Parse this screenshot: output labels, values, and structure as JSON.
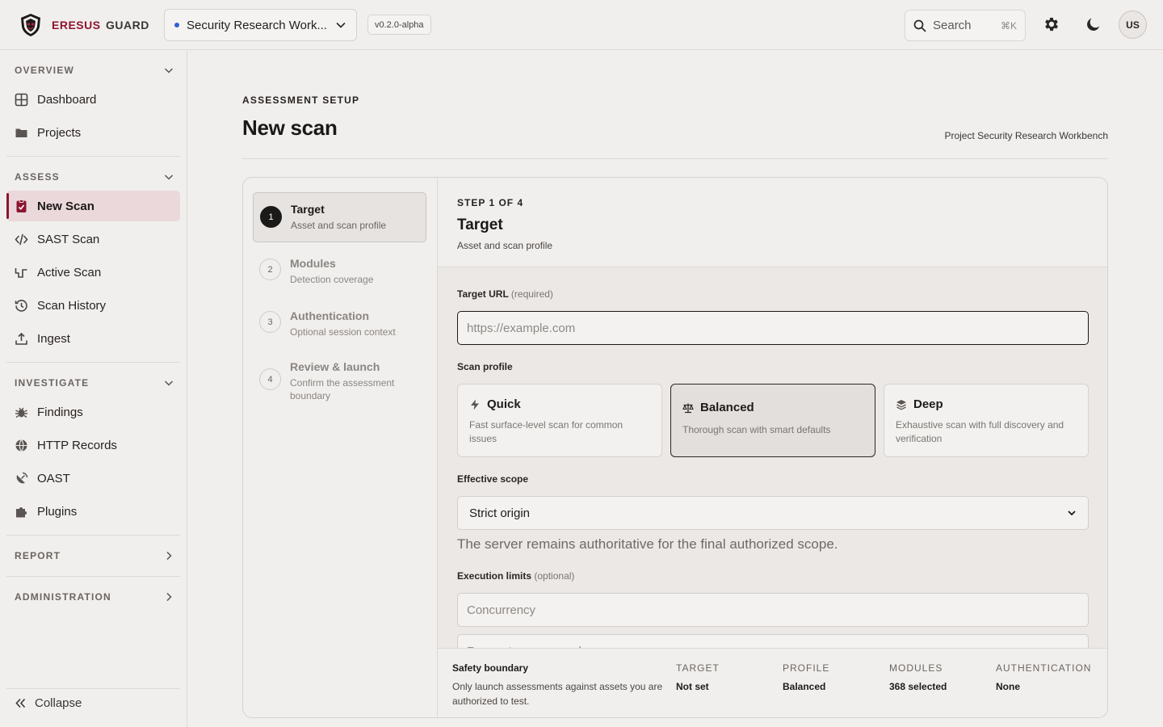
{
  "brand": {
    "name": "ERESUS",
    "suffix": "GUARD"
  },
  "header": {
    "workspace": "Security Research Work...",
    "version": "v0.2.0-alpha",
    "search_label": "Search",
    "search_shortcut": "⌘K",
    "avatar": "US"
  },
  "sidebar": {
    "overview": {
      "title": "OVERVIEW",
      "items": [
        "Dashboard",
        "Projects"
      ]
    },
    "assess": {
      "title": "ASSESS",
      "items": [
        "New Scan",
        "SAST Scan",
        "Active Scan",
        "Scan History",
        "Ingest"
      ]
    },
    "investigate": {
      "title": "INVESTIGATE",
      "items": [
        "Findings",
        "HTTP Records",
        "OAST",
        "Plugins"
      ]
    },
    "report": {
      "title": "REPORT"
    },
    "administration": {
      "title": "ADMINISTRATION"
    },
    "collapse_label": "Collapse",
    "active_item": "New Scan"
  },
  "page": {
    "eyebrow": "ASSESSMENT SETUP",
    "title": "New scan",
    "project": "Project Security Research Workbench"
  },
  "steps": [
    {
      "num": "1",
      "title": "Target",
      "sub": "Asset and scan profile",
      "active": true
    },
    {
      "num": "2",
      "title": "Modules",
      "sub": "Detection coverage",
      "active": false
    },
    {
      "num": "3",
      "title": "Authentication",
      "sub": "Optional session context",
      "active": false
    },
    {
      "num": "4",
      "title": "Review & launch",
      "sub": "Confirm the assessment boundary",
      "active": false
    }
  ],
  "content": {
    "step_of": "STEP 1 OF 4",
    "title": "Target",
    "sub": "Asset and scan profile",
    "target_url_label": "Target URL",
    "target_url_hint": "(required)",
    "target_url_placeholder": "https://example.com",
    "target_url_value": "",
    "scan_profile_label": "Scan profile",
    "profiles": [
      {
        "name": "Quick",
        "desc": "Fast surface-level scan for common issues",
        "icon": "bolt-icon"
      },
      {
        "name": "Balanced",
        "desc": "Thorough scan with smart defaults",
        "icon": "scale-icon",
        "selected": true
      },
      {
        "name": "Deep",
        "desc": "Exhaustive scan with full discovery and verification",
        "icon": "layers-icon"
      }
    ],
    "scope_label": "Effective scope",
    "scope_value": "Strict origin",
    "scope_help": "The server remains authoritative for the final authorized scope.",
    "limits_label": "Execution limits",
    "limits_hint": "(optional)",
    "concurrency_placeholder": "Concurrency",
    "requests_placeholder": "Requests per second"
  },
  "footer": {
    "safety_title": "Safety boundary",
    "safety_text": "Only launch assessments against assets you are authorized to test.",
    "stats": [
      {
        "key": "TARGET",
        "value": "Not set"
      },
      {
        "key": "PROFILE",
        "value": "Balanced"
      },
      {
        "key": "MODULES",
        "value": "368 selected"
      },
      {
        "key": "AUTHENTICATION",
        "value": "None"
      }
    ]
  },
  "colors": {
    "accent": "#8d1530",
    "active_bg": "#ead8db",
    "border": "#dcd8d5",
    "background": "#f1efed"
  }
}
